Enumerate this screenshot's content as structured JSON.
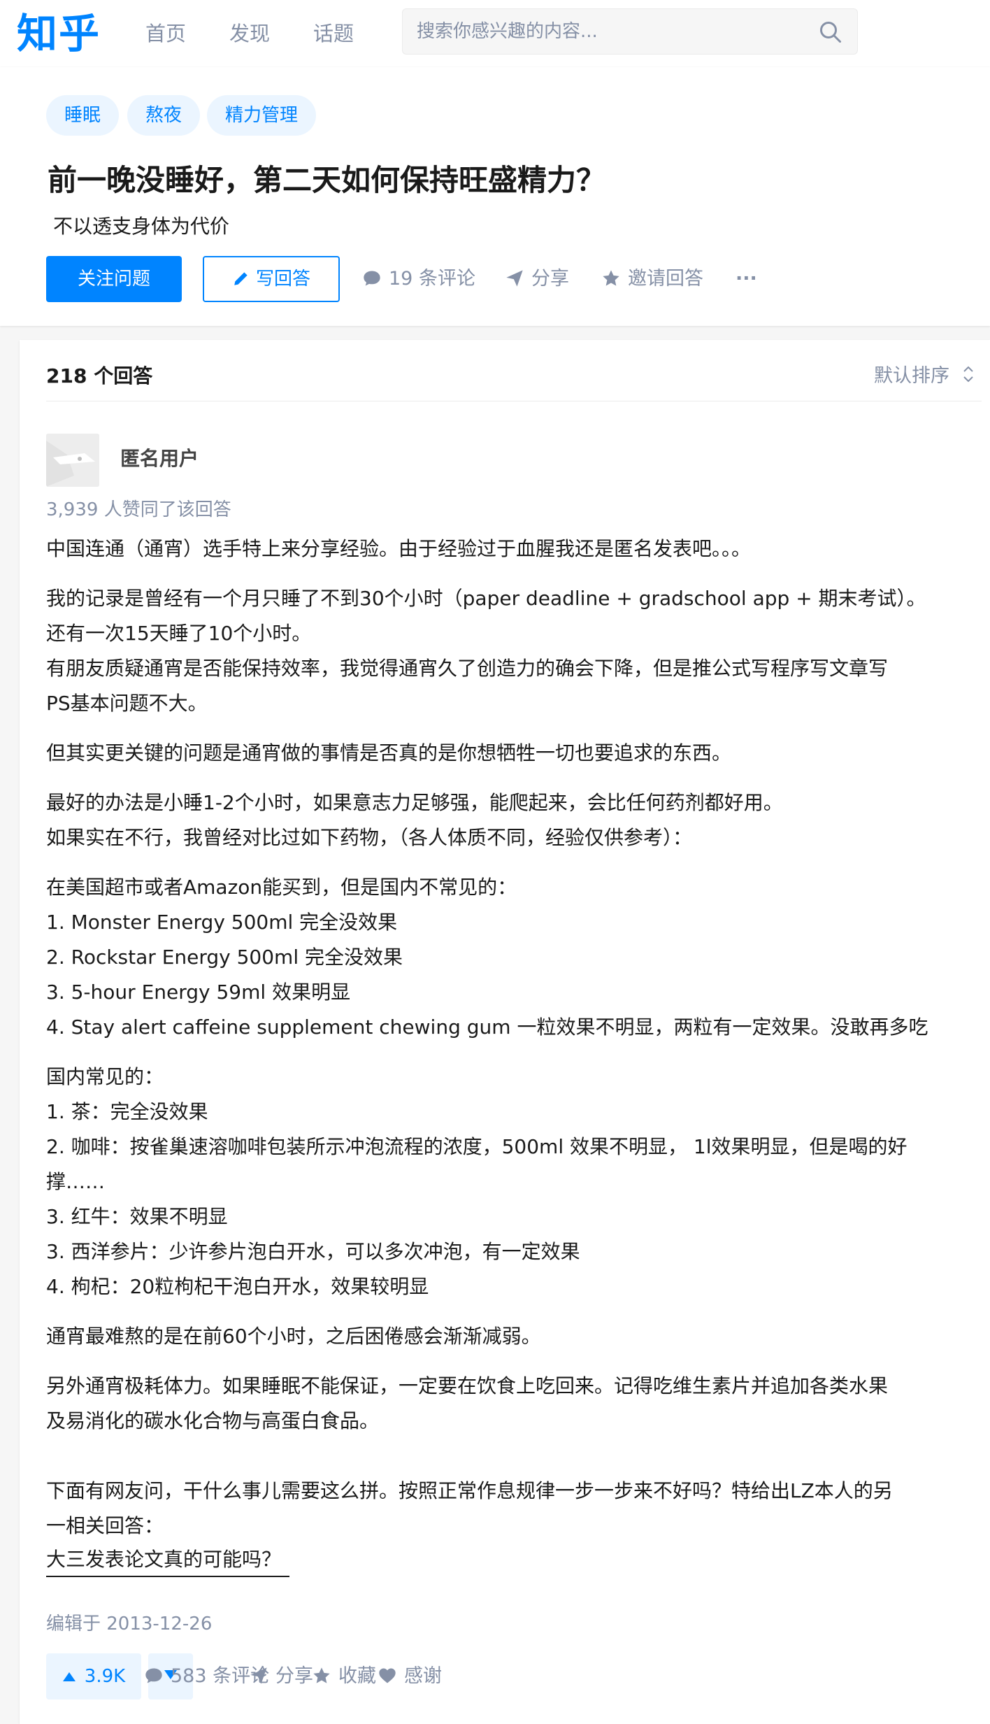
{
  "header": {
    "logo": "知乎",
    "nav": [
      "首页",
      "发现",
      "话题"
    ],
    "search_placeholder": "搜索你感兴趣的内容..."
  },
  "question": {
    "tags": [
      "睡眠",
      "熬夜",
      "精力管理"
    ],
    "title": "前一晚没睡好，第二天如何保持旺盛精力？",
    "detail": "不以透支身体为代价",
    "follow_label": "关注问题",
    "write_label": "写回答",
    "comments_label": "19 条评论",
    "share_label": "分享",
    "invite_label": "邀请回答",
    "more_label": "···"
  },
  "answers_header": {
    "count_label": "218 个回答",
    "sort_label": "默认排序"
  },
  "answer": {
    "author": "匿名用户",
    "votes_text": "3,939 人赞同了该回答",
    "paragraphs": [
      [
        "中国连通（通宵）选手特上来分享经验。由于经验过于血腥我还是匿名发表吧。。。"
      ],
      [
        "我的记录是曾经有一个月只睡了不到30个小时（paper deadline + gradschool app + 期末考试）。",
        "还有一次15天睡了10个小时。",
        "有朋友质疑通宵是否能保持效率，我觉得通宵久了创造力的确会下降，但是推公式写程序写文章写",
        "PS基本问题不大。"
      ],
      [
        "但其实更关键的问题是通宵做的事情是否真的是你想牺牲一切也要追求的东西。"
      ],
      [
        "最好的办法是小睡1-2个小时，如果意志力足够强，能爬起来，会比任何药剂都好用。",
        "如果实在不行，我曾经对比过如下药物，（各人体质不同，经验仅供参考）："
      ],
      [
        "在美国超市或者Amazon能买到，但是国内不常见的：",
        "1. Monster Energy 500ml 完全没效果",
        "2. Rockstar Energy 500ml 完全没效果",
        "3. 5-hour Energy 59ml 效果明显",
        "4. Stay alert caffeine supplement chewing gum 一粒效果不明显，两粒有一定效果。没敢再多吃"
      ],
      [
        "国内常见的：",
        "1. 茶：完全没效果",
        "2. 咖啡：按雀巢速溶咖啡包装所示冲泡流程的浓度，500ml 效果不明显， 1l效果明显，但是喝的好",
        "撑……",
        "3. 红牛：效果不明显",
        "3. 西洋参片：少许参片泡白开水，可以多次冲泡，有一定效果",
        "4. 枸杞：20粒枸杞干泡白开水，效果较明显"
      ],
      [
        "通宵最难熬的是在前60个小时，之后困倦感会渐渐减弱。"
      ],
      [
        "另外通宵极耗体力。如果睡眠不能保证，一定要在饮食上吃回来。记得吃维生素片并追加各类水果",
        "及易消化的碳水化合物与高蛋白食品。"
      ],
      [
        "下面有网友问，干什么事儿需要这么拼。按照正常作息规律一步一步来不好吗？特给出LZ本人的另",
        "一相关回答："
      ]
    ],
    "related_link": "大三发表论文真的可能吗？",
    "edited": "编辑于 2013-12-26",
    "upvote_label": "3.9K",
    "comments_label": "583 条评论",
    "share_label": "分享",
    "collect_label": "收藏",
    "thanks_label": "感谢"
  },
  "colors": {
    "brand": "#0084ff",
    "muted": "#8590a6",
    "tag_bg": "#ebf5ff"
  }
}
